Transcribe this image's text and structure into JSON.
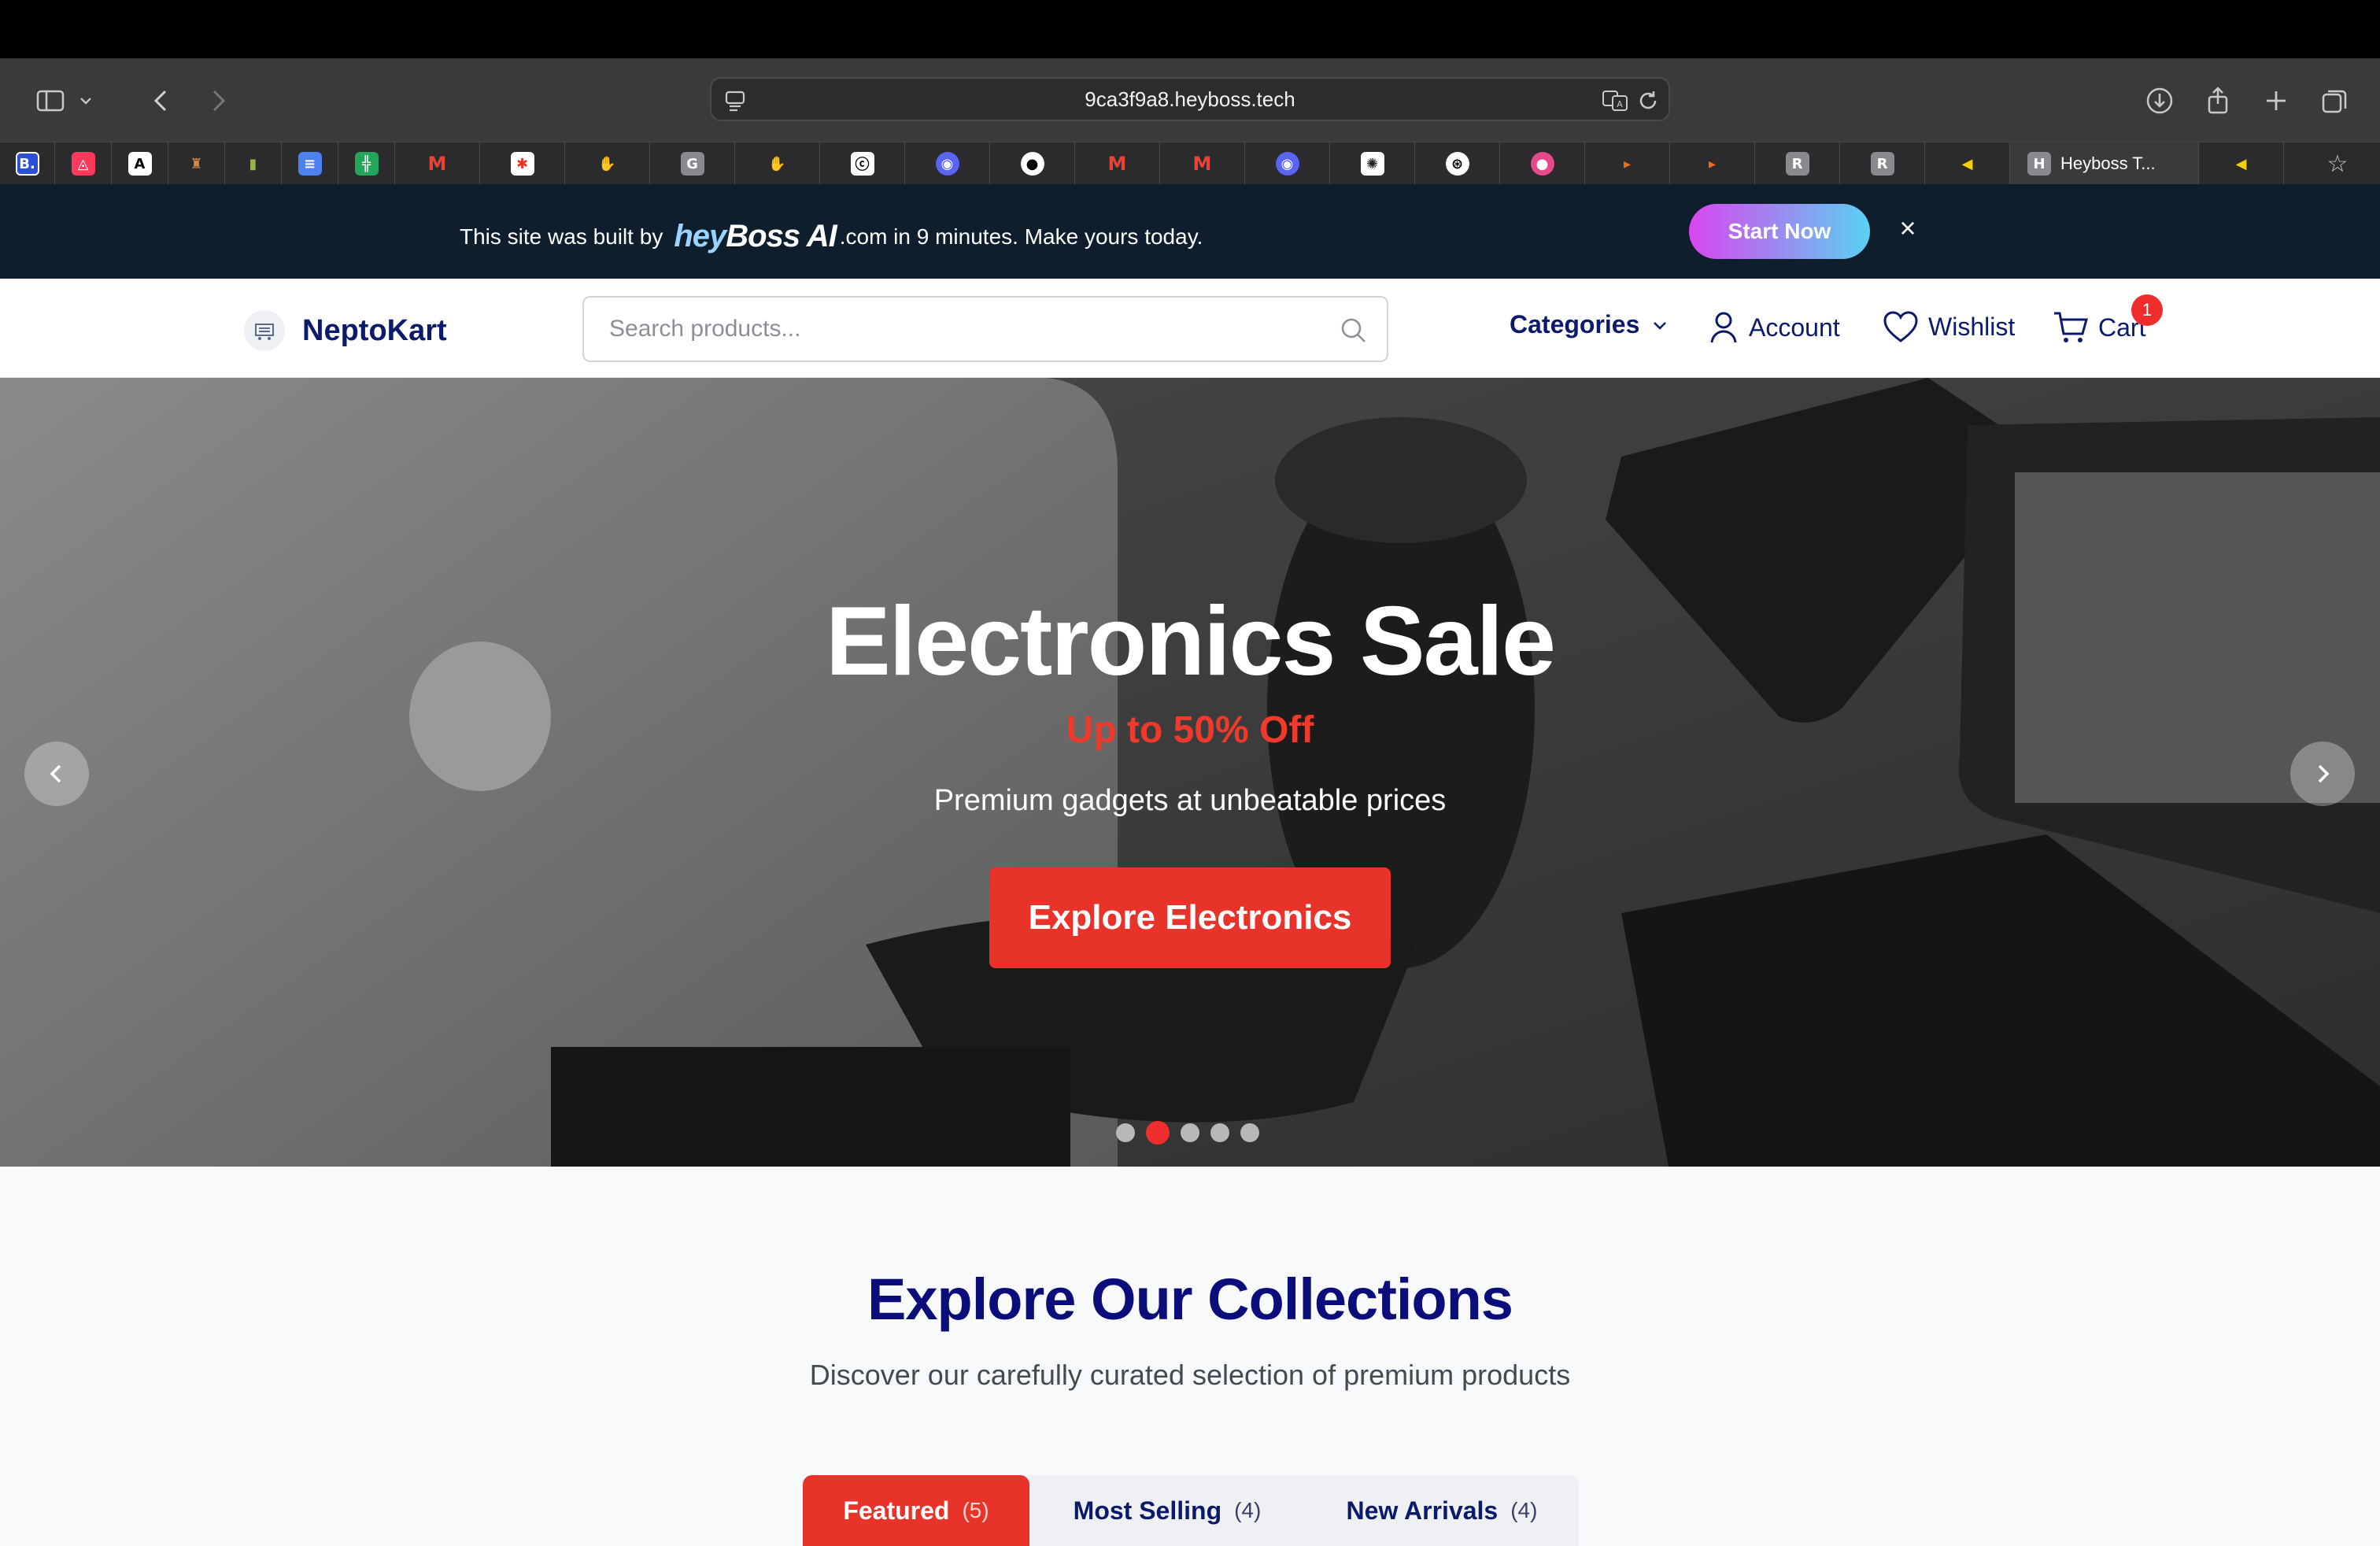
{
  "browser": {
    "url": "9ca3f9a8.heyboss.tech",
    "active_tab_title": "Heyboss T...",
    "tabs": [
      "B.",
      "airbnb",
      "A",
      "cup",
      "bottle",
      "docs",
      "sheets",
      "M",
      "figma",
      "hand",
      "G",
      "hand",
      "copilot",
      "discord",
      "github",
      "M",
      "M",
      "discord",
      "slack-like",
      "openai",
      "circle",
      "orange",
      "orange",
      "R",
      "R",
      "yellow"
    ]
  },
  "promo": {
    "prefix": "This site was built by",
    "brand_hey": "hey",
    "brand_boss": "Boss",
    "brand_ai": "AI",
    "suffix": ".com in 9 minutes. Make yours today.",
    "cta": "Start Now",
    "close": "×"
  },
  "header": {
    "logo_text": "NeptoKart",
    "search_placeholder": "Search products...",
    "categories": "Categories",
    "account": "Account",
    "wishlist": "Wishlist",
    "cart": "Cart",
    "cart_count": "1"
  },
  "hero": {
    "title": "Electronics Sale",
    "subtitle": "Up to 50% Off",
    "description": "Premium gadgets at unbeatable prices",
    "button": "Explore Electronics",
    "slides_total": 5,
    "active_slide": 2
  },
  "collections": {
    "title": "Explore Our Collections",
    "subtitle": "Discover our carefully curated selection of premium products",
    "tabs": [
      {
        "label": "Featured",
        "count": "(5)"
      },
      {
        "label": "Most Selling",
        "count": "(4)"
      },
      {
        "label": "New Arrivals",
        "count": "(4)"
      }
    ]
  },
  "colors": {
    "accent": "#e8332a",
    "navy": "#0b1a6b",
    "promo_bg": "#0f1e2c"
  }
}
